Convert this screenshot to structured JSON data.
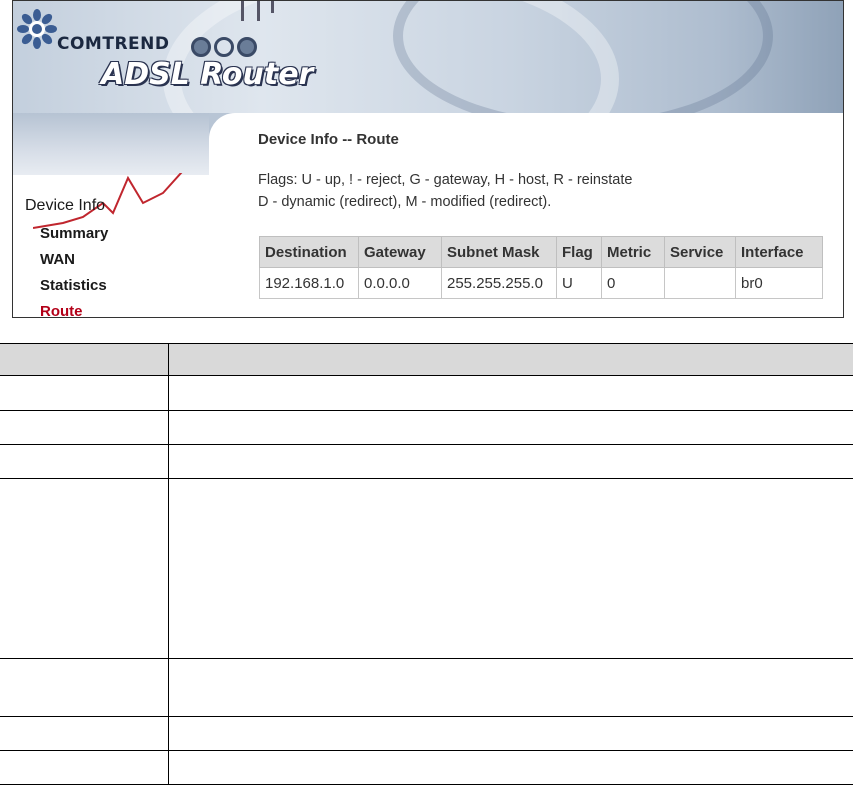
{
  "brand": {
    "logo_text": "COMTREND",
    "product_name": "ADSL Router"
  },
  "sidebar": {
    "section": "Device Info",
    "items": [
      {
        "label": "Summary",
        "active": false
      },
      {
        "label": "WAN",
        "active": false
      },
      {
        "label": "Statistics",
        "active": false
      },
      {
        "label": "Route",
        "active": true
      }
    ]
  },
  "page": {
    "title": "Device Info -- Route",
    "flags_line1": "Flags: U - up, ! - reject, G - gateway, H - host, R - reinstate",
    "flags_line2": "D - dynamic (redirect), M - modified (redirect)."
  },
  "route_table": {
    "headers": [
      "Destination",
      "Gateway",
      "Subnet Mask",
      "Flag",
      "Metric",
      "Service",
      "Interface"
    ],
    "rows": [
      [
        "192.168.1.0",
        "0.0.0.0",
        "255.255.255.0",
        "U",
        "0",
        "",
        "br0"
      ]
    ]
  },
  "colors": {
    "active_nav": "#b30018",
    "table_header_bg": "#dcdcdc",
    "accent_border": "#aa2233"
  }
}
